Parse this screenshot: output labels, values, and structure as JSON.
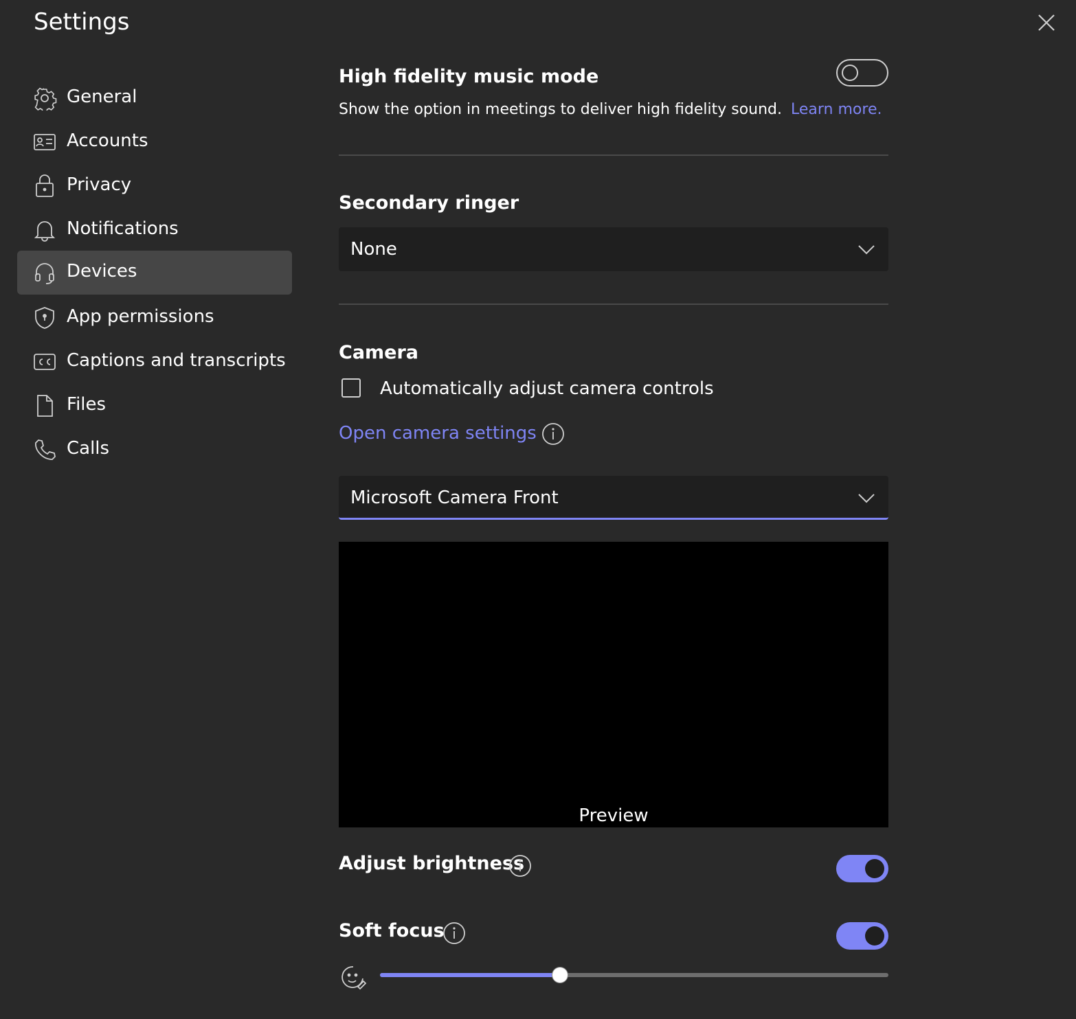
{
  "header": {
    "title": "Settings",
    "close_icon": "close-icon"
  },
  "sidebar": {
    "items": [
      {
        "label": "General",
        "icon": "gear-icon",
        "selected": false
      },
      {
        "label": "Accounts",
        "icon": "id-card-icon",
        "selected": false
      },
      {
        "label": "Privacy",
        "icon": "lock-icon",
        "selected": false
      },
      {
        "label": "Notifications",
        "icon": "bell-icon",
        "selected": false
      },
      {
        "label": "Devices",
        "icon": "headset-icon",
        "selected": true
      },
      {
        "label": "App permissions",
        "icon": "shield-icon",
        "selected": false
      },
      {
        "label": "Captions and transcripts",
        "icon": "cc-icon",
        "selected": false
      },
      {
        "label": "Files",
        "icon": "file-icon",
        "selected": false
      },
      {
        "label": "Calls",
        "icon": "phone-icon",
        "selected": false
      }
    ]
  },
  "hifi_music": {
    "heading": "High fidelity music mode",
    "description": "Show the option in meetings to deliver high fidelity sound.",
    "learn_more": "Learn more.",
    "enabled": false
  },
  "secondary_ringer": {
    "heading": "Secondary ringer",
    "selected": "None"
  },
  "camera": {
    "heading": "Camera",
    "auto_adjust_label": "Automatically adjust camera controls",
    "auto_adjust_checked": false,
    "open_settings_link": "Open camera settings",
    "device": "Microsoft Camera Front",
    "preview_label": "Preview"
  },
  "adjust_brightness": {
    "heading": "Adjust brightness",
    "enabled": true
  },
  "soft_focus": {
    "heading": "Soft focus",
    "enabled": true,
    "level_fraction": 0.354
  },
  "colors": {
    "accent": "#7f85f5",
    "background": "#292929",
    "selected_nav": "#464646",
    "field": "#1f1f1f"
  }
}
